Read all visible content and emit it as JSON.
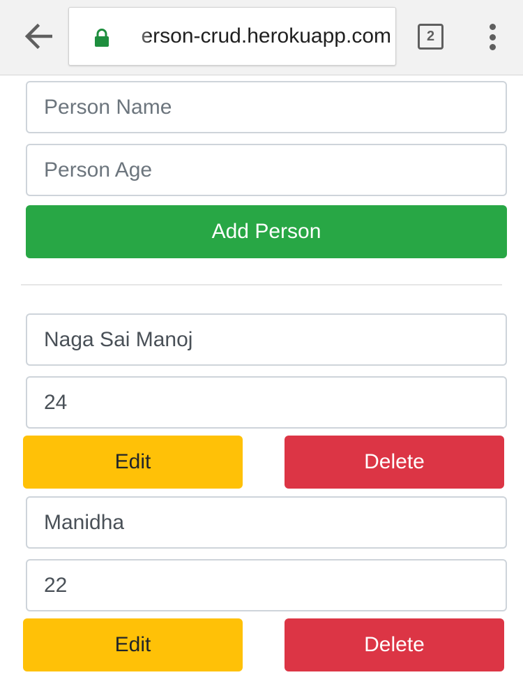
{
  "browser": {
    "url_text": "erson-crud.herokuapp.com",
    "tab_count": "2",
    "colors": {
      "lock": "#1e8e3e"
    }
  },
  "form": {
    "name_placeholder": "Person Name",
    "age_placeholder": "Person Age",
    "add_button_label": "Add Person"
  },
  "persons": [
    {
      "name": "Naga Sai Manoj",
      "age": "24",
      "edit_label": "Edit",
      "delete_label": "Delete"
    },
    {
      "name": "Manidha",
      "age": "22",
      "edit_label": "Edit",
      "delete_label": "Delete"
    }
  ],
  "colors": {
    "success": "#28a745",
    "warning": "#ffc107",
    "danger": "#dc3545"
  }
}
